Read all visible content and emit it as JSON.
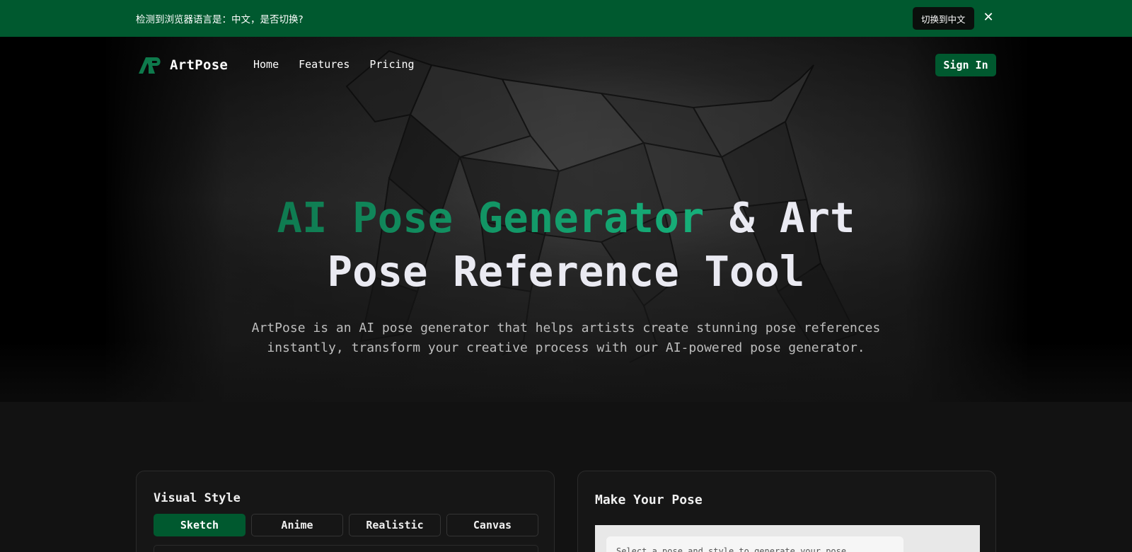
{
  "language_banner": {
    "message": "检测到浏览器语言是：中文，是否切换?",
    "switch_label": "切换到中文",
    "close_glyph": "✕"
  },
  "nav": {
    "brand": "ArtPose",
    "links": [
      "Home",
      "Features",
      "Pricing"
    ],
    "sign_in": "Sign In"
  },
  "hero": {
    "title_accent": "AI Pose Generator",
    "title_rest_line1": " & Art",
    "title_line2": "Pose Reference Tool",
    "subtitle_line1": "ArtPose is an AI pose generator that helps artists create stunning pose references",
    "subtitle_line2": "instantly, transform your creative process with our AI-powered pose generator."
  },
  "visual_style": {
    "title": "Visual Style",
    "options": [
      "Sketch",
      "Anime",
      "Realistic",
      "Canvas"
    ],
    "selected": "Sketch"
  },
  "make_pose": {
    "title": "Make Your Pose",
    "hint": "Select a pose and style to generate your pose"
  },
  "colors": {
    "brand_green": "#00592f",
    "accent_green": "#12a06b",
    "page_bg": "#121212"
  }
}
